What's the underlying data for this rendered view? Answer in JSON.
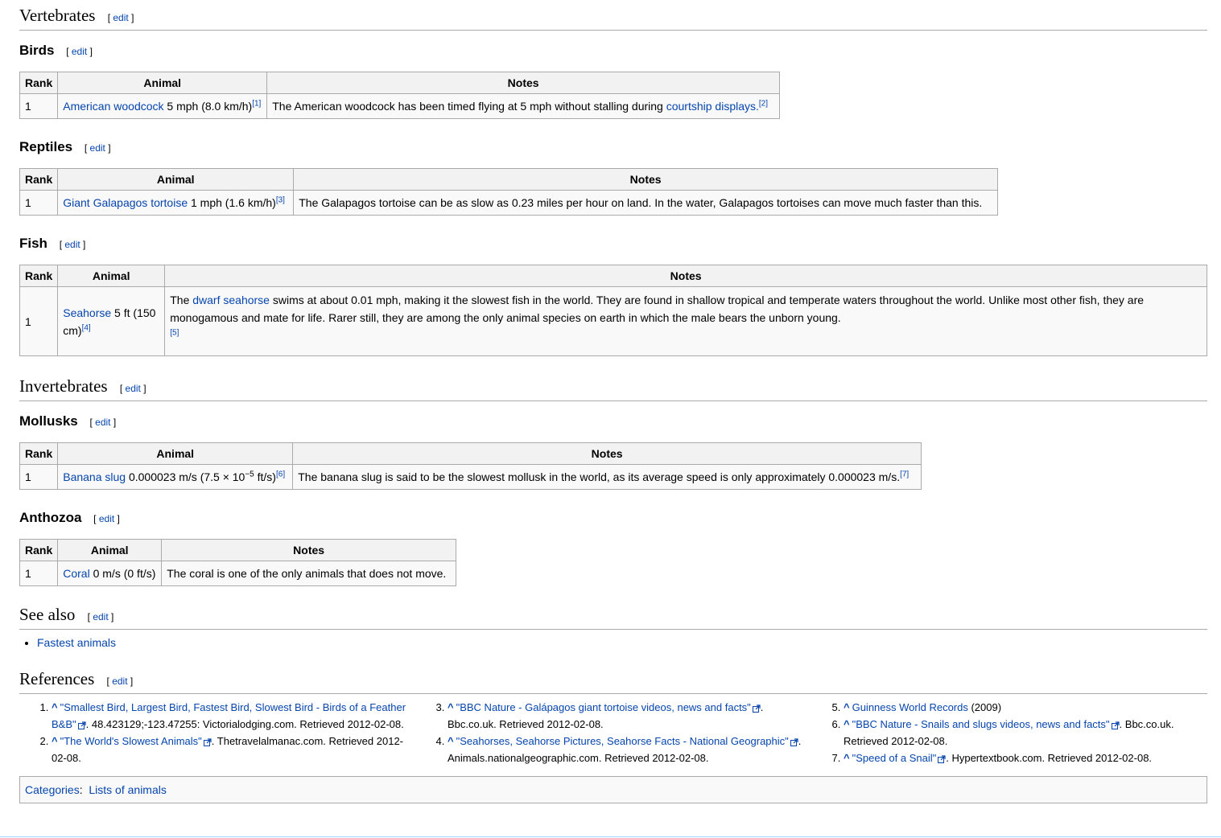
{
  "edit_label": "edit",
  "sections": {
    "vertebrates": {
      "title": "Vertebrates"
    },
    "invertebrates": {
      "title": "Invertebrates"
    },
    "see_also": {
      "title": "See also",
      "items": [
        "Fastest animals"
      ]
    },
    "references": {
      "title": "References"
    }
  },
  "table_headers": {
    "rank": "Rank",
    "animal": "Animal",
    "notes": "Notes"
  },
  "birds": {
    "title": "Birds",
    "rank": "1",
    "animal_link": "American woodcock",
    "animal_speed": " 5 mph (8.0 km/h)",
    "animal_ref": "[1]",
    "notes_text": "The American woodcock has been timed flying at 5 mph without stalling during ",
    "notes_link": "courtship displays.",
    "notes_ref": "[2]"
  },
  "reptiles": {
    "title": "Reptiles",
    "rank": "1",
    "animal_link": "Giant Galapagos tortoise",
    "animal_speed": " 1 mph (1.6 km/h)",
    "animal_ref": "[3]",
    "notes_text": "The Galapagos tortoise can be as slow as 0.23 miles per hour on land. In the water, Galapagos tortoises can move much faster than this."
  },
  "fish": {
    "title": "Fish",
    "rank": "1",
    "animal_link": "Seahorse",
    "animal_speed": " 5 ft (150 cm)",
    "animal_ref": "[4]",
    "notes_pre": "The ",
    "notes_link": "dwarf seahorse",
    "notes_text": " swims at about 0.01 mph, making it the slowest fish in the world. They are found in shallow tropical and temperate waters throughout the world. Unlike most other fish, they are monogamous and mate for life. Rarer still, they are among the only animal species on earth in which the male bears the unborn young.",
    "notes_ref": "[5]"
  },
  "mollusks": {
    "title": "Mollusks",
    "rank": "1",
    "animal_link": "Banana slug",
    "animal_speed_a": " 0.000023 m/s (7.5 × 10",
    "animal_speed_exp": "−5",
    "animal_speed_b": " ft/s)",
    "animal_ref": "[6]",
    "notes_text": "The banana slug is said to be the slowest mollusk in the world, as its average speed is only approximately 0.000023 m/s.",
    "notes_ref": "[7]"
  },
  "anthozoa": {
    "title": "Anthozoa",
    "rank": "1",
    "animal_link": "Coral",
    "animal_speed": " 0 m/s (0 ft/s)",
    "notes_text": "The coral is one of the only animals that does not move."
  },
  "references": {
    "caret": "^",
    "r1": {
      "link": "\"Smallest Bird, Largest Bird, Fastest Bird, Slowest Bird - Birds of a Feather B&B\"",
      "rest": ". 48.423129;-123.47255: Victorialodging.com. Retrieved 2012-02-08."
    },
    "r2": {
      "link": "\"The World's Slowest Animals\"",
      "rest": ". Thetravelalmanac.com. Retrieved 2012-02-08."
    },
    "r3": {
      "link": "\"BBC Nature - Galápagos giant tortoise videos, news and facts\"",
      "rest": ". Bbc.co.uk. Retrieved 2012-02-08."
    },
    "r4": {
      "link": "\"Seahorses, Seahorse Pictures, Seahorse Facts - National Geographic\"",
      "rest": ". Animals.nationalgeographic.com. Retrieved 2012-02-08."
    },
    "r5": {
      "link": "Guinness World Records",
      "rest": " (2009)"
    },
    "r6": {
      "link": "\"BBC Nature - Snails and slugs videos, news and facts\"",
      "rest": ". Bbc.co.uk. Retrieved 2012-02-08."
    },
    "r7": {
      "link": "\"Speed of a Snail\"",
      "rest": ". Hypertextbook.com. Retrieved 2012-02-08."
    }
  },
  "categories": {
    "label": "Categories",
    "items": [
      "Lists of animals"
    ]
  },
  "colors": {
    "link": "#0645ad",
    "table_header_bg": "#f2f2f2",
    "table_bg": "#f9f9f9",
    "border": "#aaaaaa"
  }
}
